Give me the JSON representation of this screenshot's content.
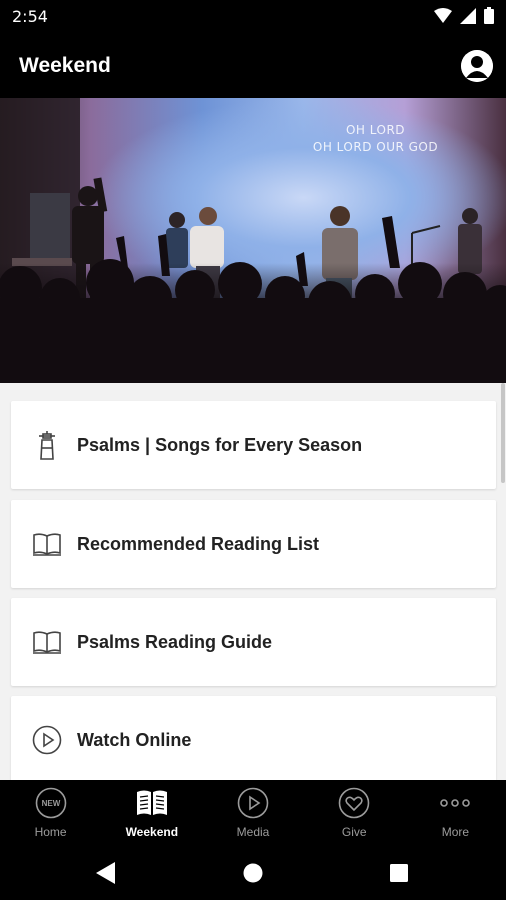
{
  "status_bar": {
    "time": "2:54"
  },
  "app_bar": {
    "title": "Weekend"
  },
  "hero": {
    "lyric_line_1": "OH LORD",
    "lyric_line_2": "OH LORD OUR GOD"
  },
  "cards": [
    {
      "label": "Psalms | Songs for Every Season",
      "icon": "lighthouse-icon"
    },
    {
      "label": "Recommended Reading List",
      "icon": "open-book-icon"
    },
    {
      "label": "Psalms Reading Guide",
      "icon": "open-book-icon"
    },
    {
      "label": "Watch Online",
      "icon": "play-circle-icon"
    }
  ],
  "bottom_nav": {
    "items": [
      {
        "label": "Home",
        "icon": "new-badge-icon",
        "active": false
      },
      {
        "label": "Weekend",
        "icon": "book-icon",
        "active": true
      },
      {
        "label": "Media",
        "icon": "play-circle-icon",
        "active": false
      },
      {
        "label": "Give",
        "icon": "heart-circle-icon",
        "active": false
      },
      {
        "label": "More",
        "icon": "more-dots-icon",
        "active": false
      }
    ],
    "new_badge_text": "NEW"
  },
  "colors": {
    "background": "#000000",
    "active_nav": "#ffffff",
    "inactive_nav": "#9b9b9b",
    "content_bg": "#f2f2f2"
  }
}
